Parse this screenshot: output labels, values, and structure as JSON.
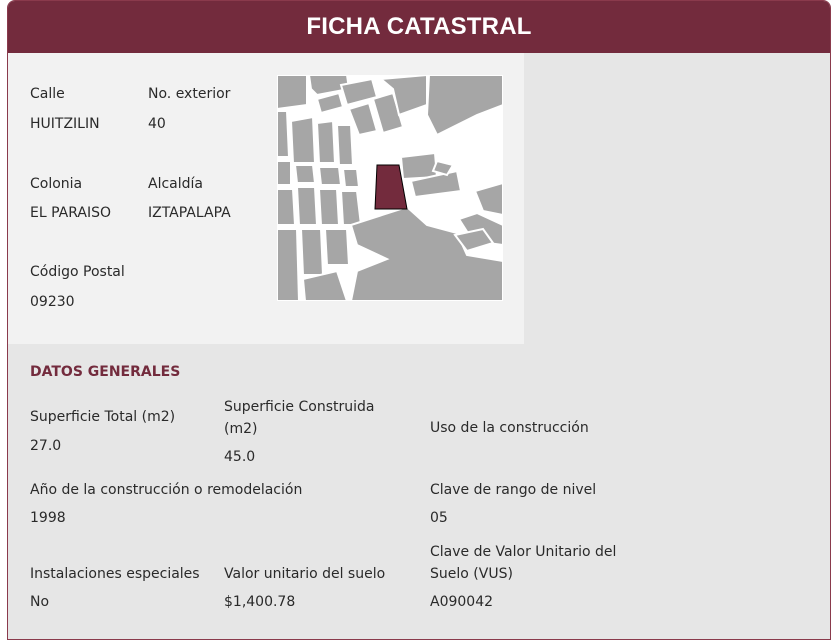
{
  "header": {
    "title": "FICHA CATASTRAL"
  },
  "location": {
    "calle_label": "Calle",
    "calle_value": "HUITZILIN",
    "exterior_label": "No. exterior",
    "exterior_value": "40",
    "colonia_label": "Colonia",
    "colonia_value": "EL PARAISO",
    "alcaldia_label": "Alcaldía",
    "alcaldia_value": "IZTAPALAPA",
    "cp_label": "Código Postal",
    "cp_value": "09230"
  },
  "general": {
    "title": "DATOS GENERALES",
    "sup_total_label": "Superficie Total (m2)",
    "sup_total_value": "27.0",
    "sup_construida_label_1": "Superficie Construida",
    "sup_construida_label_2": "(m2)",
    "sup_construida_value": "45.0",
    "uso_label": "Uso de la construcción",
    "uso_value": "",
    "anio_label": "Año de la construcción o remodelación",
    "anio_value": "1998",
    "rango_label": "Clave de rango de nivel",
    "rango_value": "05",
    "instalaciones_label": "Instalaciones especiales",
    "instalaciones_value": "No",
    "valor_label": "Valor unitario del suelo",
    "valor_value": "$1,400.78",
    "vus_label_1": "Clave de Valor Unitario del",
    "vus_label_2": "Suelo (VUS)",
    "vus_value": "A090042"
  },
  "colors": {
    "brand": "#732b3d",
    "panel": "#f2f2f2",
    "background": "#e6e6e6",
    "block": "#a6a6a6",
    "highlight": "#732b3d"
  },
  "map": {
    "icon": "parcel-map"
  }
}
